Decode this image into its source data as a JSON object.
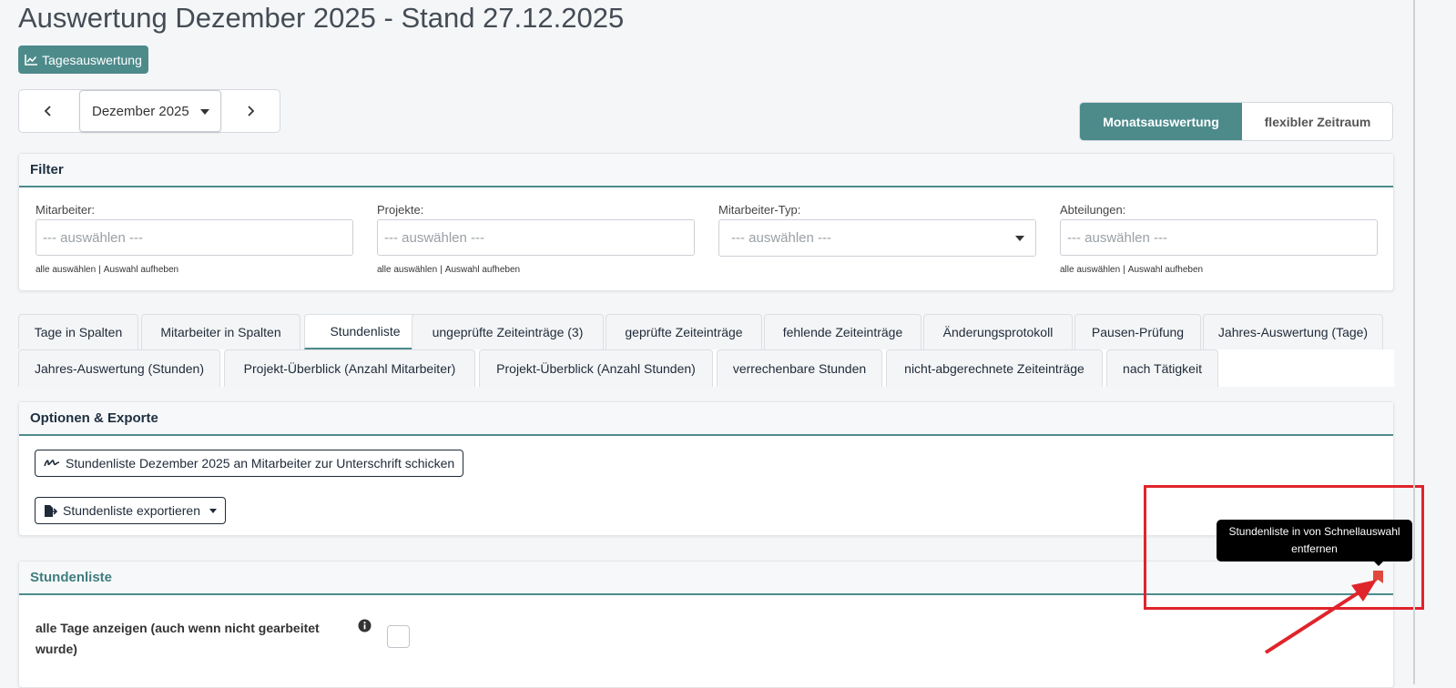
{
  "page": {
    "title": "Auswertung Dezember 2025 - Stand 27.12.2025"
  },
  "toolbar": {
    "daily_button_label": "Tagesauswertung",
    "month_select_value": "Dezember 2025",
    "prev_icon": "chevron-left-icon",
    "next_icon": "chevron-right-icon"
  },
  "mode_toggle": {
    "monthly_label": "Monatsauswertung",
    "flexible_label": "flexibler Zeitraum",
    "active": "monthly"
  },
  "filter": {
    "title": "Filter",
    "fields": [
      {
        "label": "Mitarbeiter:",
        "placeholder": "--- auswählen ---",
        "select_all": "alle auswählen",
        "clear": "Auswahl aufheben"
      },
      {
        "label": "Projekte:",
        "placeholder": "--- auswählen ---",
        "select_all": "alle auswählen",
        "clear": "Auswahl aufheben"
      },
      {
        "label": "Mitarbeiter-Typ:",
        "placeholder": "--- auswählen ---"
      },
      {
        "label": "Abteilungen:",
        "placeholder": "--- auswählen ---",
        "select_all": "alle auswählen",
        "clear": "Auswahl aufheben"
      }
    ]
  },
  "tabs": {
    "row1": [
      "Tage in Spalten",
      "Mitarbeiter in Spalten",
      "Stundenliste",
      "ungeprüfte Zeiteinträge (3)",
      "geprüfte Zeiteinträge",
      "fehlende Zeiteinträge",
      "Änderungsprotokoll",
      "Pausen-Prüfung",
      "Jahres-Auswertung (Tage)"
    ],
    "row2": [
      "Jahres-Auswertung (Stunden)",
      "Projekt-Überblick (Anzahl Mitarbeiter)",
      "Projekt-Überblick (Anzahl Stunden)",
      "verrechenbare Stunden",
      "nicht-abgerechnete Zeiteinträge",
      "nach Tätigkeit"
    ],
    "active": "Stundenliste"
  },
  "options": {
    "title": "Optionen & Exporte",
    "send_button_label": "Stundenliste Dezember 2025 an Mitarbeiter zur Unterschrift schicken",
    "export_button_label": "Stundenliste exportieren"
  },
  "stundenliste": {
    "title": "Stundenliste",
    "show_all_days_label": "alle Tage anzeigen (auch wenn nicht gearbeitet wurde)",
    "show_all_days_checked": false,
    "bookmark_tooltip": "Stundenliste in von Schnellauswahl entfernen"
  },
  "colors": {
    "accent": "#4d8b8b",
    "annotation": "#e0242b",
    "bookmark": "#e0483e"
  }
}
